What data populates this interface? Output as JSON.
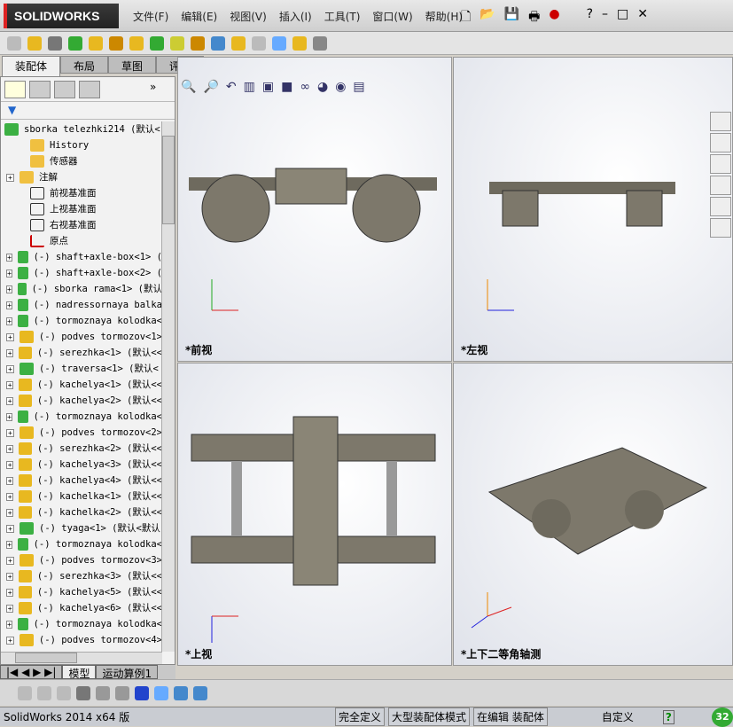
{
  "app": {
    "logo": "SOLIDWORKS",
    "menus": [
      "文件(F)",
      "编辑(E)",
      "视图(V)",
      "插入(I)",
      "工具(T)",
      "窗口(W)",
      "帮助(H)"
    ]
  },
  "tabs": [
    "装配体",
    "布局",
    "草图",
    "评估"
  ],
  "tree": {
    "root": "sborka telezhki214 (默认<",
    "items": [
      {
        "label": "History",
        "icon": "history-folder-icon",
        "expand": false
      },
      {
        "label": "传感器",
        "icon": "sensor-folder-icon",
        "expand": false
      },
      {
        "label": "注解",
        "icon": "annotation-folder-icon",
        "expand": true
      },
      {
        "label": "前视基准面",
        "icon": "plane-icon",
        "expand": false
      },
      {
        "label": "上视基准面",
        "icon": "plane-icon",
        "expand": false
      },
      {
        "label": "右视基准面",
        "icon": "plane-icon",
        "expand": false
      },
      {
        "label": "原点",
        "icon": "origin-icon",
        "expand": false
      },
      {
        "label": "(-) shaft+axle-box<1> (",
        "icon": "subassembly-icon",
        "expand": true
      },
      {
        "label": "(-) shaft+axle-box<2> (",
        "icon": "subassembly-icon",
        "expand": true
      },
      {
        "label": "(-) sborka rama<1> (默认",
        "icon": "subassembly-icon",
        "expand": true
      },
      {
        "label": "(-) nadressornaya balka",
        "icon": "subassembly-icon",
        "expand": true
      },
      {
        "label": "(-) tormoznaya kolodka<",
        "icon": "subassembly-icon",
        "expand": true
      },
      {
        "label": "(-) podves tormozov<1>",
        "icon": "part-icon",
        "expand": true
      },
      {
        "label": "(-) serezhka<1> (默认<<",
        "icon": "part-icon",
        "expand": true
      },
      {
        "label": "(-) traversa<1> (默认<",
        "icon": "subassembly-icon",
        "expand": true
      },
      {
        "label": "(-) kachelya<1> (默认<<",
        "icon": "part-icon",
        "expand": true
      },
      {
        "label": "(-) kachelya<2> (默认<<",
        "icon": "part-icon",
        "expand": true
      },
      {
        "label": "(-) tormoznaya kolodka<",
        "icon": "subassembly-icon",
        "expand": true
      },
      {
        "label": "(-) podves tormozov<2>",
        "icon": "part-icon",
        "expand": true
      },
      {
        "label": "(-) serezhka<2> (默认<<",
        "icon": "part-icon",
        "expand": true
      },
      {
        "label": "(-) kachelya<3> (默认<<",
        "icon": "part-icon",
        "expand": true
      },
      {
        "label": "(-) kachelya<4> (默认<<",
        "icon": "part-icon",
        "expand": true
      },
      {
        "label": "(-) kachelka<1> (默认<<",
        "icon": "part-icon",
        "expand": true
      },
      {
        "label": "(-) kachelka<2> (默认<<",
        "icon": "part-icon",
        "expand": true
      },
      {
        "label": "(-) tyaga<1> (默认<默认",
        "icon": "subassembly-icon",
        "expand": true
      },
      {
        "label": "(-) tormoznaya kolodka<",
        "icon": "subassembly-icon",
        "expand": true
      },
      {
        "label": "(-) podves tormozov<3>",
        "icon": "part-icon",
        "expand": true
      },
      {
        "label": "(-) serezhka<3> (默认<<",
        "icon": "part-icon",
        "expand": true
      },
      {
        "label": "(-) kachelya<5> (默认<<",
        "icon": "part-icon",
        "expand": true
      },
      {
        "label": "(-) kachelya<6> (默认<<",
        "icon": "part-icon",
        "expand": true
      },
      {
        "label": "(-) tormoznaya kolodka<",
        "icon": "subassembly-icon",
        "expand": true
      },
      {
        "label": "(-) podves tormozov<4>",
        "icon": "part-icon",
        "expand": true
      }
    ]
  },
  "bottom_tabs": [
    "模型",
    "运动算例1"
  ],
  "viewports": {
    "front": "*前视",
    "left": "*左视",
    "top": "*上视",
    "iso": "*上下二等角轴测"
  },
  "status": {
    "version": "SolidWorks 2014 x64 版",
    "cells": [
      "完全定义",
      "大型装配体模式",
      "在编辑 装配体"
    ],
    "custom": "自定义",
    "badge": "32"
  },
  "colors": {
    "part": "#e8b820",
    "subassembly": "#3cb043",
    "model": "#6e6a5e"
  }
}
